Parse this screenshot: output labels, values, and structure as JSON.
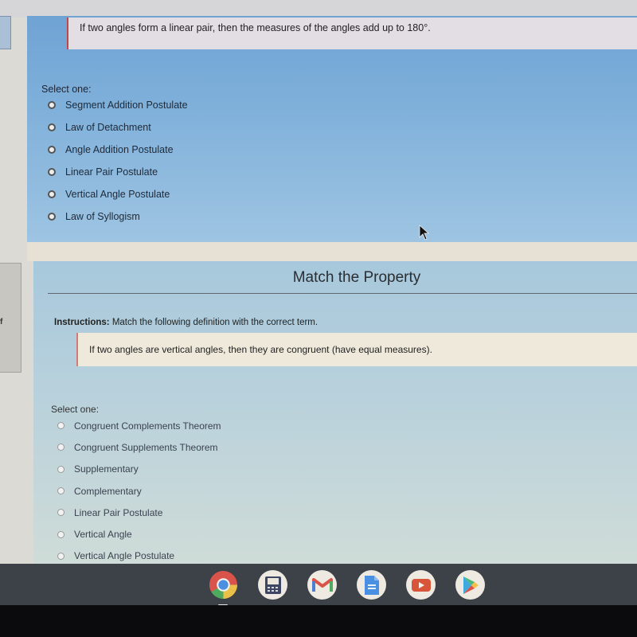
{
  "question1": {
    "definition": "If two angles form a linear pair, then the measures of the angles add up to 180°.",
    "select_label": "Select one:",
    "options": [
      {
        "label": "Segment Addition Postulate",
        "selected": false
      },
      {
        "label": "Law of Detachment",
        "selected": false
      },
      {
        "label": "Angle Addition Postulate",
        "selected": false
      },
      {
        "label": "Linear Pair Postulate",
        "selected": false
      },
      {
        "label": "Vertical Angle Postulate",
        "selected": false
      },
      {
        "label": "Law of Syllogism",
        "selected": false
      }
    ]
  },
  "question2": {
    "title": "Match the Property",
    "instructions_label": "Instructions:",
    "instructions_text": " Match the following definition with the correct term.",
    "definition": "If two angles are vertical angles, then they are congruent (have equal measures).",
    "select_label": "Select one:",
    "options": [
      {
        "label": "Congruent Complements Theorem",
        "selected": false
      },
      {
        "label": "Congruent Supplements Theorem",
        "selected": false
      },
      {
        "label": "Supplementary",
        "selected": false
      },
      {
        "label": "Complementary",
        "selected": false
      },
      {
        "label": "Linear Pair Postulate",
        "selected": false
      },
      {
        "label": "Vertical Angle",
        "selected": false
      },
      {
        "label": "Vertical Angle Postulate",
        "selected": false
      }
    ]
  },
  "side_nav": {
    "stub_mark": "f"
  },
  "shelf": {
    "apps": [
      {
        "name": "Chrome",
        "icon": "chrome-icon",
        "active": true
      },
      {
        "name": "Calculator",
        "icon": "calculator-icon",
        "active": false
      },
      {
        "name": "Gmail",
        "icon": "gmail-icon",
        "active": false
      },
      {
        "name": "Google Docs",
        "icon": "docs-icon",
        "active": false
      },
      {
        "name": "YouTube",
        "icon": "youtube-icon",
        "active": false
      },
      {
        "name": "Play Store",
        "icon": "play-store-icon",
        "active": false
      }
    ]
  },
  "colors": {
    "accent_red": "#c0484a",
    "card1_blue": "#7fb0da",
    "shelf": "#3c4248"
  }
}
